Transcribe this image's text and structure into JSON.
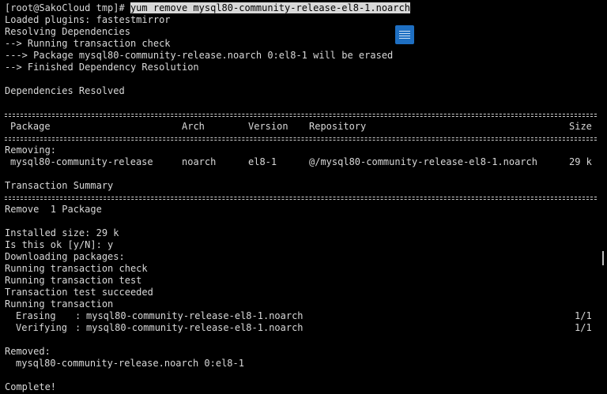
{
  "terminal": {
    "prompt": "[root@SakoCloud tmp]# ",
    "command": "yum remove mysql80-community-release-el8-1.noarch",
    "lines_before": [
      "Loaded plugins: fastestmirror",
      "Resolving Dependencies",
      "--> Running transaction check",
      "---> Package mysql80-community-release.noarch 0:el8-1 will be erased",
      "--> Finished Dependency Resolution",
      "",
      "Dependencies Resolved",
      ""
    ],
    "table": {
      "headers": [
        "Package",
        "Arch",
        "Version",
        "Repository",
        "Size"
      ],
      "section_label": "Removing:",
      "row": [
        "mysql80-community-release",
        "noarch",
        "el8-1",
        "@/mysql80-community-release-el8-1.noarch",
        "29 k"
      ],
      "summary_title": "Transaction Summary",
      "summary_line": "Remove  1 Package"
    },
    "lines_after": [
      "",
      "Installed size: 29 k",
      "Is this ok [y/N]: y",
      "Downloading packages:",
      "Running transaction check",
      "Running transaction test",
      "Transaction test succeeded",
      "Running transaction"
    ],
    "actions": [
      {
        "verb": "Erasing",
        "target": "mysql80-community-release-el8-1.noarch",
        "progress": "1/1"
      },
      {
        "verb": "Verifying",
        "target": "mysql80-community-release-el8-1.noarch",
        "progress": "1/1"
      }
    ],
    "removed_label": "Removed:",
    "removed_item": "mysql80-community-release.noarch 0:el8-1",
    "complete": "Complete!"
  },
  "overlay": {
    "icon": "document-icon",
    "icon_color": "#1e6fc2"
  }
}
